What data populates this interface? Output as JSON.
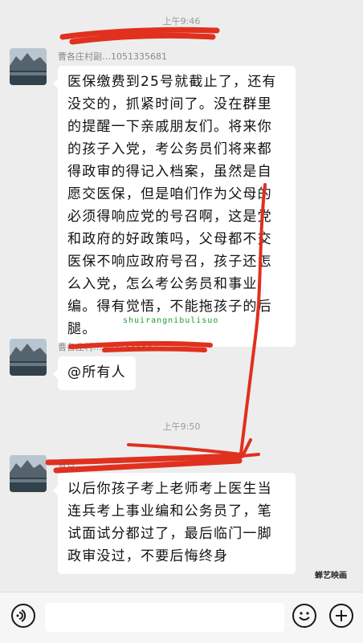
{
  "chat": {
    "time_1": "上午9:46",
    "time_2": "上午9:50",
    "sender_1": "曹各庄村副…1051335681",
    "sender_2": "曹各庄村…1051335681",
    "sender_3": "曹各",
    "message_1": "医保缴费到25号就截止了，还有没交的，抓紧时间了。没在群里的提醒一下亲戚朋友们。将来你的孩子入党，考公务员们将来都得政审的得记入档案，虽然是自愿交医保，但是咱们作为父母的必须得响应党的号召啊，这是党和政府的好政策吗，父母都不交医保不响应政府号召，孩子还怎么入党，怎么考公务员和事业编。得有觉悟，不能拖孩子的后腿。",
    "message_2": "@所有人",
    "message_3": "以后你孩子考上老师考上医生当连兵考上事业编和公务员了，笔试面试分都过了，最后临门一脚政审没过，不要后悔终身"
  },
  "watermarks": {
    "text_watermark": "shuirangnibulisuo",
    "corner_mark": "蝉艺映画"
  },
  "input_bar": {
    "voice_icon": "voice-icon",
    "emoji_icon": "emoji-icon",
    "plus_icon": "plus-icon"
  },
  "colors": {
    "background": "#ededed",
    "bubble": "#ffffff",
    "annotation_red": "#e0301e",
    "watermark_green": "#1e9a3a"
  }
}
